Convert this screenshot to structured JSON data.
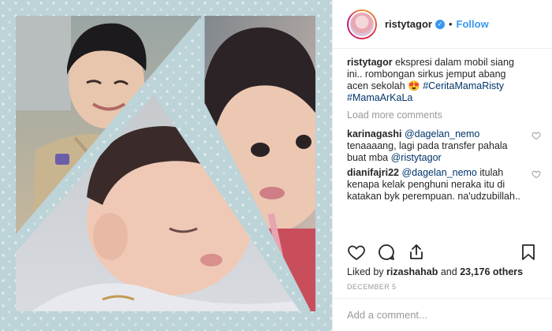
{
  "post": {
    "username": "ristytagor",
    "follow_label": "Follow",
    "dot": "•",
    "verified_glyph": "✓"
  },
  "caption": {
    "username": "ristytagor",
    "text": "ekspresi dalam mobil siang ini.. rombongan sirkus jemput abang acen sekolah 😍",
    "hashtags": "#CeritaMamaRisty #MamaArKaLa"
  },
  "load_more_label": "Load more comments",
  "comments": [
    {
      "username": "karinagashi",
      "mention": "@dagelan_nemo",
      "text": "tenaaaang, lagi pada transfer pahala buat mba",
      "mention2": "@ristytagor"
    },
    {
      "username": "dianifajri22",
      "mention": "@dagelan_nemo",
      "text": "itulah kenapa kelak penghuni neraka itu di katakan byk perempuan. na'udzubillah.."
    }
  ],
  "likes": {
    "prefix": "Liked by",
    "user": "rizashahab",
    "and": "and",
    "others": "23,176 others"
  },
  "date": "DECEMBER 5",
  "add_comment_placeholder": "Add a comment...",
  "colors": {
    "link": "#3897f0",
    "mention": "#003569",
    "muted": "#999999",
    "photo_bg": "#bcd3d8"
  },
  "icons": [
    "heart-icon",
    "comment-icon",
    "share-icon",
    "bookmark-icon",
    "verified-badge-icon"
  ]
}
